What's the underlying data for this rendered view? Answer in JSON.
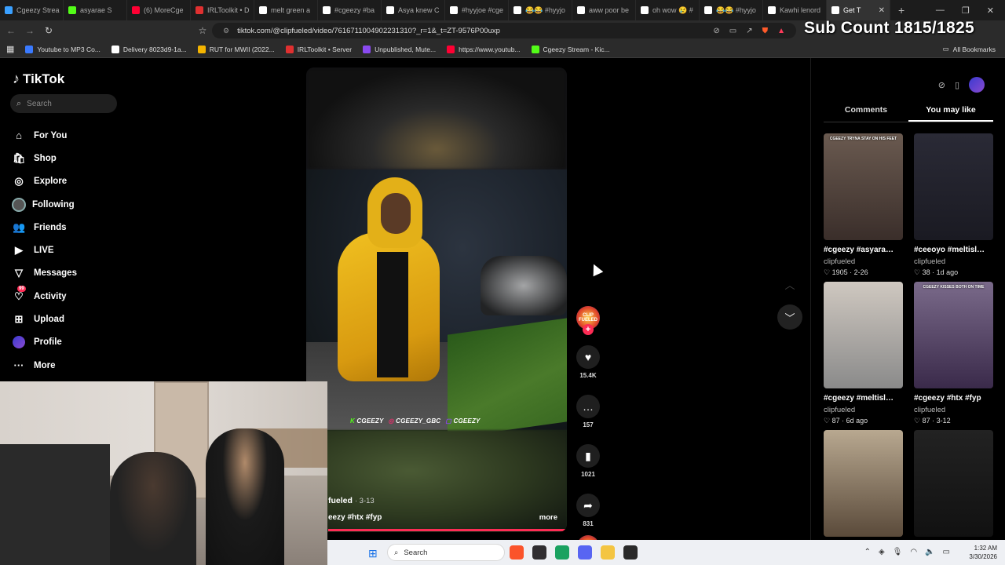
{
  "browser": {
    "tabs": [
      {
        "label": "Cgeezy Strea",
        "color": "#3aa0ff"
      },
      {
        "label": "asyarae S",
        "color": "#53fc18"
      },
      {
        "label": "(6) MoreCge",
        "color": "#ff0033"
      },
      {
        "label": "IRLToolkit • D",
        "color": "#e03030"
      },
      {
        "label": "melt green a",
        "color": "#ffffff"
      },
      {
        "label": "#cgeezy #ba",
        "color": "#ffffff"
      },
      {
        "label": "Asya knew C",
        "color": "#ffffff"
      },
      {
        "label": "#hyyjoe #cge",
        "color": "#ffffff"
      },
      {
        "label": "😂😂 #hyyjo",
        "color": "#ffffff"
      },
      {
        "label": "aww poor be",
        "color": "#ffffff"
      },
      {
        "label": "oh wow 😢 #",
        "color": "#ffffff"
      },
      {
        "label": "😂😂 #hyyjo",
        "color": "#ffffff"
      },
      {
        "label": "Kawhi lenord",
        "color": "#ffffff"
      },
      {
        "label": "Get T",
        "color": "#ffffff",
        "active": true
      }
    ],
    "url": "tiktok.com/@clipfueled/video/7616711004902231310?_r=1&_t=ZT-9576P00uxp",
    "bookmarks": [
      {
        "label": "Youtube to MP3 Co...",
        "color": "#3a7aff"
      },
      {
        "label": "Delivery 8023d9-1a...",
        "color": "#ffffff"
      },
      {
        "label": "RUT for MWII (2022...",
        "color": "#f4b400"
      },
      {
        "label": "IRLToolkit • Server",
        "color": "#e03030"
      },
      {
        "label": "Unpublished, Mute...",
        "color": "#8a4af0"
      },
      {
        "label": "https://www.youtub...",
        "color": "#ff0033"
      },
      {
        "label": "Cgeezy Stream - Kic...",
        "color": "#53fc18"
      }
    ],
    "all_bookmarks": "All Bookmarks"
  },
  "overlay": {
    "sub_count": "Sub Count 1815/1825"
  },
  "sidebar": {
    "logo": "TikTok",
    "search_placeholder": "Search",
    "items": [
      {
        "label": "For You",
        "icon": "home-icon"
      },
      {
        "label": "Shop",
        "icon": "shop-icon"
      },
      {
        "label": "Explore",
        "icon": "compass-icon"
      },
      {
        "label": "Following",
        "icon": "following-avatar"
      },
      {
        "label": "Friends",
        "icon": "friends-icon"
      },
      {
        "label": "LIVE",
        "icon": "live-icon"
      },
      {
        "label": "Messages",
        "icon": "messages-icon"
      },
      {
        "label": "Activity",
        "icon": "activity-icon",
        "badge": "99"
      },
      {
        "label": "Upload",
        "icon": "upload-icon"
      },
      {
        "label": "Profile",
        "icon": "profile-avatar"
      },
      {
        "label": "More",
        "icon": "more-icon"
      }
    ]
  },
  "video": {
    "social_tags": [
      "CGEEZY",
      "CGEEZY_GBC",
      "CGEEZY"
    ],
    "author": "fueled",
    "date": "3-13",
    "description": "eezy #htx #fyp",
    "more": "more",
    "likes": "15.4K",
    "comments": "157",
    "bookmarks": "1021",
    "shares": "831",
    "creator_badge": "CLIP FUELED"
  },
  "right_panel": {
    "tabs": [
      "Comments",
      "You may like"
    ],
    "active_tab": "You may like",
    "videos": [
      {
        "title": "#cgeezy #asyarae #fyp #htx",
        "author": "clipfueled",
        "likes": "1905",
        "date": "2-26",
        "thumb_text": "CGEEZY TRYNA STAY ON HIS FEET",
        "bg": "linear-gradient(180deg,#6a5a50,#3a2e2a)"
      },
      {
        "title": "#ceeoyo #meltislive #flo...",
        "author": "clipfueled",
        "likes": "38",
        "date": "1d ago",
        "thumb_text": "",
        "bg": "linear-gradient(180deg,#2a2a36,#1a1a22)"
      },
      {
        "title": "#cgeezy #meltislive #htx...",
        "author": "clipfueled",
        "likes": "87",
        "date": "6d ago",
        "thumb_text": "",
        "bg": "linear-gradient(180deg,#cfc8c0,#8a8a8a)"
      },
      {
        "title": "#cgeezy #htx #fyp",
        "author": "clipfueled",
        "likes": "87",
        "date": "3-12",
        "thumb_text": "CGEEZY KISSES BOTH ON TIME",
        "bg": "linear-gradient(180deg,#7a6a8a,#3a2a4a)"
      },
      {
        "title": "",
        "author": "",
        "likes": "",
        "date": "",
        "thumb_text": "",
        "bg": "linear-gradient(180deg,#b8a890,#5a4a3a)"
      },
      {
        "title": "",
        "author": "",
        "likes": "",
        "date": "",
        "thumb_text": "",
        "bg": "linear-gradient(180deg,#222,#111)"
      }
    ]
  },
  "taskbar": {
    "search": "Search",
    "time": "1:32 AM",
    "date": "3/30/2026"
  }
}
